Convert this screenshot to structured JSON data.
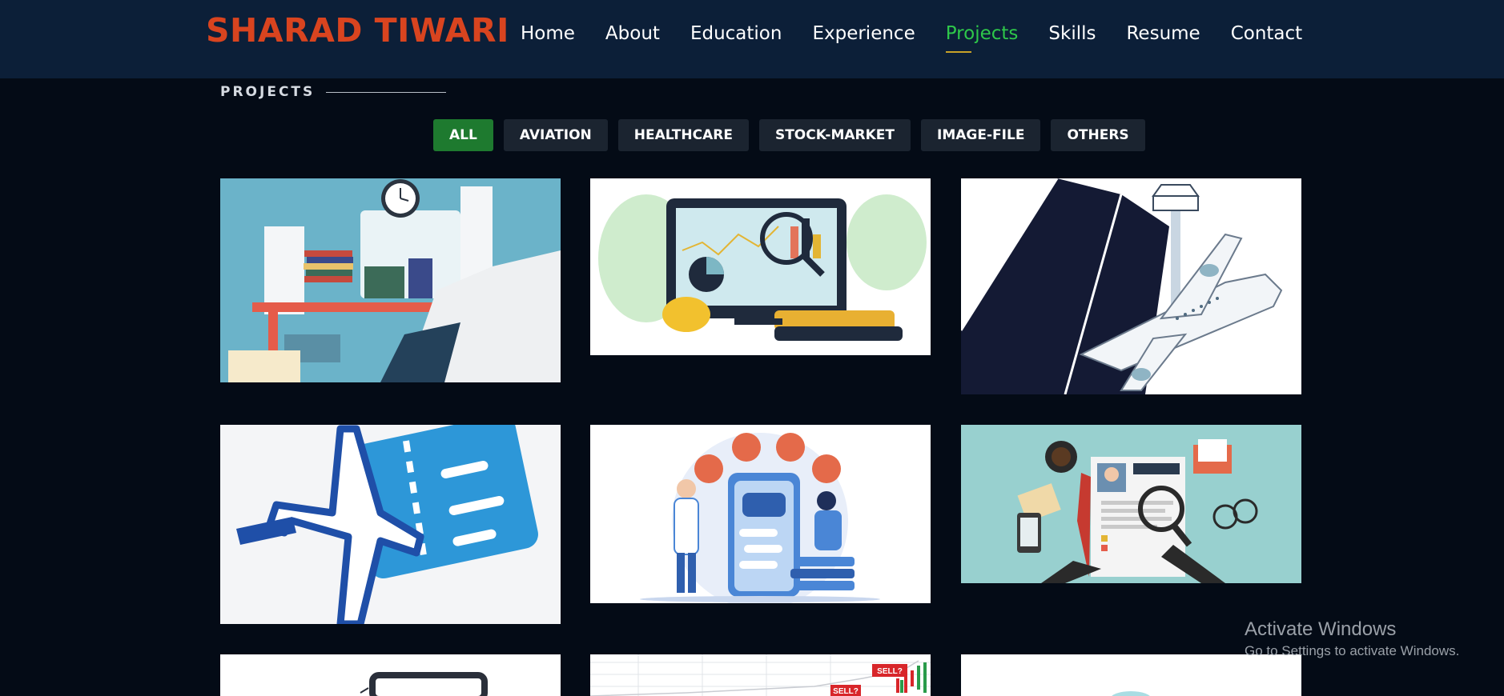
{
  "brand": {
    "name": "SHARAD TIWARI"
  },
  "nav": {
    "items": [
      {
        "label": "Home"
      },
      {
        "label": "About"
      },
      {
        "label": "Education"
      },
      {
        "label": "Experience"
      },
      {
        "label": "Projects",
        "active": true
      },
      {
        "label": "Skills"
      },
      {
        "label": "Resume"
      },
      {
        "label": "Contact"
      }
    ]
  },
  "section": {
    "title": "PROJECTS"
  },
  "filters": {
    "items": [
      {
        "label": "ALL",
        "active": true
      },
      {
        "label": "AVIATION"
      },
      {
        "label": "HEALTHCARE"
      },
      {
        "label": "STOCK-MARKET"
      },
      {
        "label": "IMAGE-FILE"
      },
      {
        "label": "OTHERS"
      }
    ]
  },
  "projects": [
    {
      "image": "office-desk-files-illustration"
    },
    {
      "image": "data-analytics-dashboard-illustration"
    },
    {
      "image": "airport-tower-airplane-illustration"
    },
    {
      "image": "airplane-ticket-icon"
    },
    {
      "image": "healthcare-chatbot-illustration"
    },
    {
      "image": "resume-review-illustration"
    },
    {
      "image": "laptop-illustration"
    },
    {
      "image": "stock-chart-illustration",
      "labels": [
        "SELL?",
        "SELL?"
      ]
    },
    {
      "image": "blank-illustration"
    }
  ],
  "watermark": {
    "title": "Activate Windows",
    "subtitle": "Go to Settings to activate Windows."
  },
  "colors": {
    "header_bg": "#0c1f38",
    "page_bg": "#040b16",
    "brand": "#d9441f",
    "nav_active": "#2ec84a",
    "filter_active": "#1e7a2f",
    "filter_bg": "#1b2430"
  }
}
